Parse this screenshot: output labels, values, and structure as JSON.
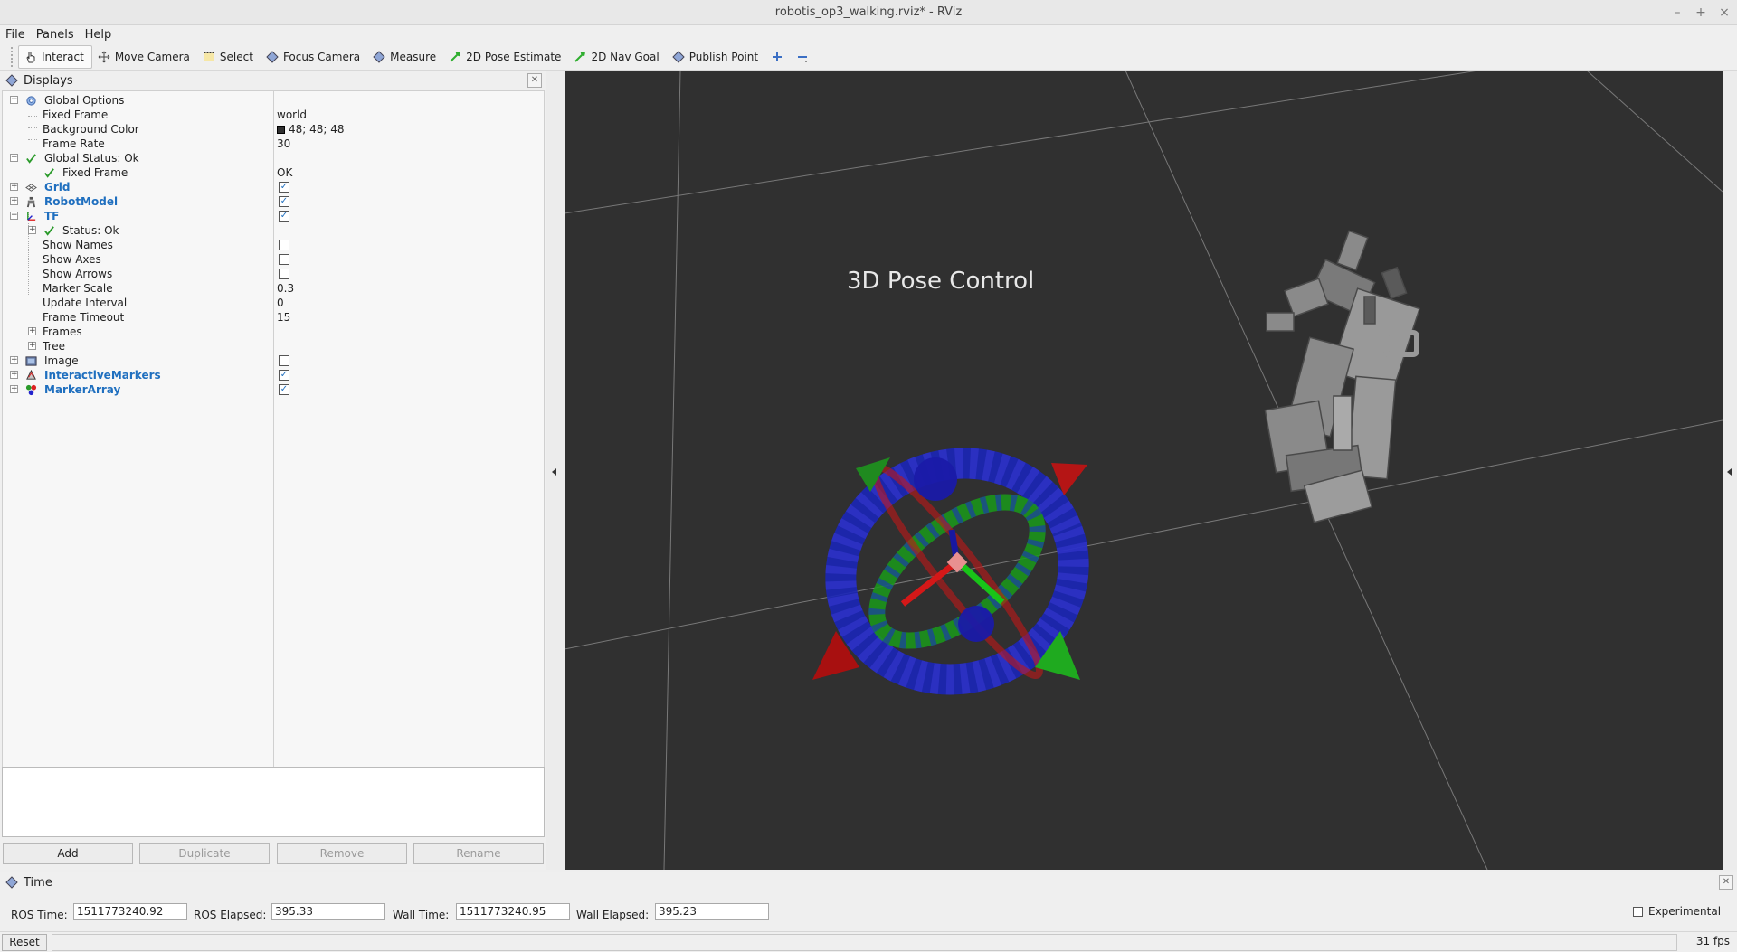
{
  "window": {
    "title": "robotis_op3_walking.rviz* - RViz"
  },
  "menu": [
    "File",
    "Panels",
    "Help"
  ],
  "toolbar": {
    "tools": [
      "Interact",
      "Move Camera",
      "Select",
      "Focus Camera",
      "Measure",
      "2D Pose Estimate",
      "2D Nav Goal",
      "Publish Point"
    ]
  },
  "displays": {
    "title": "Displays",
    "rows": [
      {
        "label": "Global Options",
        "value": ""
      },
      {
        "label": "Fixed Frame",
        "value": "world"
      },
      {
        "label": "Background Color",
        "value": "48; 48; 48"
      },
      {
        "label": "Frame Rate",
        "value": "30"
      },
      {
        "label": "Global Status: Ok",
        "value": ""
      },
      {
        "label": "Fixed Frame",
        "value": "OK"
      },
      {
        "label": "Grid",
        "checked": true
      },
      {
        "label": "RobotModel",
        "checked": true
      },
      {
        "label": "TF",
        "checked": true
      },
      {
        "label": "Status: Ok",
        "value": ""
      },
      {
        "label": "Show Names",
        "checked": false
      },
      {
        "label": "Show Axes",
        "checked": false
      },
      {
        "label": "Show Arrows",
        "checked": false
      },
      {
        "label": "Marker Scale",
        "value": "0.3"
      },
      {
        "label": "Update Interval",
        "value": "0"
      },
      {
        "label": "Frame Timeout",
        "value": "15"
      },
      {
        "label": "Frames",
        "value": ""
      },
      {
        "label": "Tree",
        "value": ""
      },
      {
        "label": "Image",
        "checked": false
      },
      {
        "label": "InteractiveMarkers",
        "checked": true
      },
      {
        "label": "MarkerArray",
        "checked": true
      }
    ],
    "buttons": [
      "Add",
      "Duplicate",
      "Remove",
      "Rename"
    ]
  },
  "viewport": {
    "marker_text": "3D  Pose  Control",
    "background": "#303030"
  },
  "time": {
    "title": "Time",
    "ros_time_label": "ROS Time:",
    "ros_time": "1511773240.92",
    "ros_elapsed_label": "ROS Elapsed:",
    "ros_elapsed": "395.33",
    "wall_time_label": "Wall Time:",
    "wall_time": "1511773240.95",
    "wall_elapsed_label": "Wall Elapsed:",
    "wall_elapsed": "395.23",
    "experimental_label": "Experimental"
  },
  "status": {
    "reset_label": "Reset",
    "fps": "31 fps"
  }
}
